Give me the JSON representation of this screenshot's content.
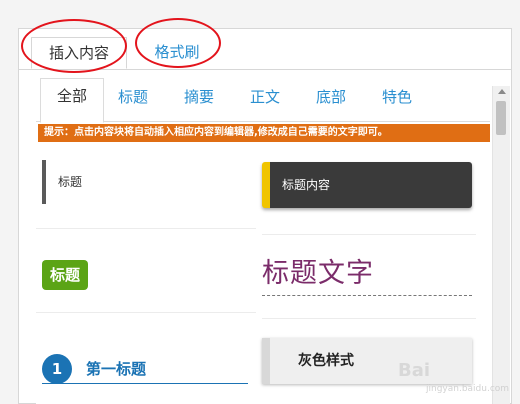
{
  "top_tabs": [
    {
      "label": "插入内容"
    },
    {
      "label": "格式刷"
    }
  ],
  "categories": [
    {
      "label": "全部"
    },
    {
      "label": "标题"
    },
    {
      "label": "摘要"
    },
    {
      "label": "正文"
    },
    {
      "label": "底部"
    },
    {
      "label": "特色"
    }
  ],
  "tip": "提示：点击内容块将自动插入相应内容到编辑器,修改成自己需要的文字即可。",
  "blocks": {
    "plain_title": "标题",
    "dark_title": "标题内容",
    "green_badge": "标题",
    "purple_title": "标题文字",
    "numbered_title": {
      "number": "1",
      "text": "第一标题"
    },
    "gray_style": "灰色样式"
  },
  "watermark": {
    "logo": "Bai",
    "sub": "jingyan.baidu.com"
  },
  "colors": {
    "accent_blue": "#2a8fd0",
    "tip_orange": "#e06e14",
    "green": "#5ba415",
    "purple": "#7b2c6a",
    "yellow": "#f0c400",
    "highlight_red": "#e3141c"
  }
}
